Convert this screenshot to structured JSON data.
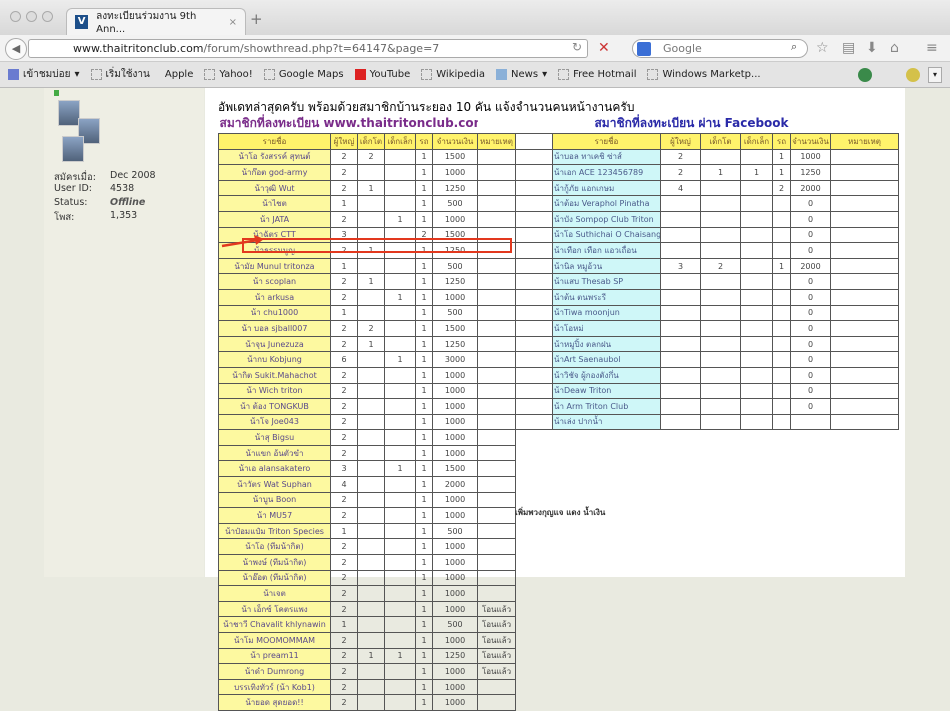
{
  "browser": {
    "tab_title": "ลงทะเบียนร่วมงาน 9th Ann...",
    "url_domain": "www.thaitritonclub.com",
    "url_path": "/forum/showthread.php?t=64147&page=7",
    "search_placeholder": "Google",
    "bookmarks": [
      "เข้าชมบ่อย",
      "เริ่มใช้งาน",
      "Apple",
      "Yahoo!",
      "Google Maps",
      "YouTube",
      "Wikipedia",
      "News",
      "Free Hotmail",
      "Windows Marketp..."
    ]
  },
  "user": {
    "labels": [
      "สมัครเมื่อ:",
      "User ID:",
      "Status:",
      "โพส:"
    ],
    "values": [
      "Dec 2008",
      "4538",
      "Offline",
      "1,353"
    ]
  },
  "post": {
    "headline": "อัพเดทล่าสุดครับ พร้อมด้วยสมาชิกบ้านระยอง 10 คัน แจ้งจำนวนคนหน้างานครับ"
  },
  "left_table": {
    "title": "สมาชิกที่ลงทะเบียน www.thaitritonclub.com",
    "headers": [
      "รายชื่อ",
      "ผู้ใหญ่",
      "เด็กโต",
      "เด็กเล็ก",
      "รถ",
      "จำนวนเงิน",
      "หมายเหตุ"
    ],
    "rows": [
      [
        "น้าโอ รังสรรค์ สุทนต์",
        "2",
        "2",
        "",
        "1",
        "1500",
        ""
      ],
      [
        "น้าก๊อต god-army",
        "2",
        "",
        "",
        "1",
        "1000",
        ""
      ],
      [
        "น้าวุฒิ Wut",
        "2",
        "1",
        "",
        "1",
        "1250",
        ""
      ],
      [
        "น้าไชต",
        "1",
        "",
        "",
        "1",
        "500",
        ""
      ],
      [
        "น้า JATA",
        "2",
        "",
        "1",
        "1",
        "1000",
        ""
      ],
      [
        "น้าฉัตร CTT",
        "3",
        "",
        "",
        "2",
        "1500",
        ""
      ],
      [
        "น้าธรรมนูญ",
        "2",
        "1",
        "",
        "1",
        "1250",
        ""
      ],
      [
        "น้ามัย Munul tritonza",
        "1",
        "",
        "",
        "1",
        "500",
        ""
      ],
      [
        "น้า scoplan",
        "2",
        "1",
        "",
        "1",
        "1250",
        ""
      ],
      [
        "น้า arkusa",
        "2",
        "",
        "1",
        "1",
        "1000",
        ""
      ],
      [
        "น้า chu1000",
        "1",
        "",
        "",
        "1",
        "500",
        ""
      ],
      [
        "น้า บอล sjball007",
        "2",
        "2",
        "",
        "1",
        "1500",
        ""
      ],
      [
        "น้าจุน Junezuza",
        "2",
        "1",
        "",
        "1",
        "1250",
        ""
      ],
      [
        "น้ากบ Kobjung",
        "6",
        "",
        "1",
        "1",
        "3000",
        ""
      ],
      [
        "น้ากิต Sukit.Mahachot",
        "2",
        "",
        "",
        "1",
        "1000",
        ""
      ],
      [
        "น้า Wich triton",
        "2",
        "",
        "",
        "1",
        "1000",
        ""
      ],
      [
        "น้า ต้อง TONGKUB",
        "2",
        "",
        "",
        "1",
        "1000",
        ""
      ],
      [
        "น้าโจ Joe043",
        "2",
        "",
        "",
        "1",
        "1000",
        ""
      ],
      [
        "น้าสุ Bigsu",
        "2",
        "",
        "",
        "1",
        "1000",
        ""
      ],
      [
        "น้าแขก อ้นตัวขำ",
        "2",
        "",
        "",
        "1",
        "1000",
        ""
      ],
      [
        "น้าเอ alansakatero",
        "3",
        "",
        "1",
        "1",
        "1500",
        ""
      ],
      [
        "น้าวัตร Wat Suphan",
        "4",
        "",
        "",
        "1",
        "2000",
        ""
      ],
      [
        "น้าบูน Boon",
        "2",
        "",
        "",
        "1",
        "1000",
        ""
      ],
      [
        "น้า MU57",
        "2",
        "",
        "",
        "1",
        "1000",
        ""
      ],
      [
        "น้าป๋อมแป๋ม Triton Species",
        "1",
        "",
        "",
        "1",
        "500",
        ""
      ],
      [
        "น้าโอ (ทีมน้ากิต)",
        "2",
        "",
        "",
        "1",
        "1000",
        ""
      ],
      [
        "น้าพงษ์ (ทีมน้ากิต)",
        "2",
        "",
        "",
        "1",
        "1000",
        ""
      ],
      [
        "น้าอ๊อต (ทีมน้ากิต)",
        "2",
        "",
        "",
        "1",
        "1000",
        ""
      ],
      [
        "น้าเจต",
        "2",
        "",
        "",
        "1",
        "1000",
        ""
      ],
      [
        "น้า เอ็กซ์ โคตรแพง",
        "2",
        "",
        "",
        "1",
        "1000",
        "โอนแล้ว"
      ],
      [
        "น้าชาวี Chavalit khlynawin",
        "1",
        "",
        "",
        "1",
        "500",
        "โอนแล้ว"
      ],
      [
        "น้าโม MOOMOMMAM",
        "2",
        "",
        "",
        "1",
        "1000",
        "โอนแล้ว"
      ],
      [
        "น้า pream11",
        "2",
        "1",
        "1",
        "1",
        "1250",
        "โอนแล้ว"
      ],
      [
        "น้าดำ Dumrong",
        "2",
        "",
        "",
        "1",
        "1000",
        "โอนแล้ว"
      ],
      [
        "บรรเทิงทัวร์ (น้า Kob1)",
        "2",
        "",
        "",
        "1",
        "1000",
        ""
      ],
      [
        "น้ายอด สุดยอด!!",
        "2",
        "",
        "",
        "1",
        "1000",
        ""
      ]
    ],
    "extra_note": "เพิ่มพวงกุญแจ แดง น้ำเงิน"
  },
  "right_table": {
    "title": "สมาชิกที่ลงทะเบียน ผ่าน Facebook",
    "headers": [
      "รายชื่อ",
      "ผู้ใหญ่",
      "เด็กโต",
      "เด็กเล็ก",
      "รถ",
      "จำนวนเงิน",
      "หมายเหตุ"
    ],
    "rows": [
      [
        "น้าบอล ทาเคชิ ซ่าส์",
        "2",
        "",
        "",
        "1",
        "1000",
        ""
      ],
      [
        "น้าเอก ACE 123456789",
        "2",
        "1",
        "1",
        "1",
        "1250",
        ""
      ],
      [
        "น้ากู้ภัย แอกเกษม",
        "4",
        "",
        "",
        "2",
        "2000",
        ""
      ],
      [
        "น้าต้อม Veraphol Pinatha",
        "",
        "",
        "",
        "",
        "0",
        ""
      ],
      [
        "น้าบัง Sompop Club Triton",
        "",
        "",
        "",
        "",
        "0",
        ""
      ],
      [
        "น้าโอ Suthichai O Chaisang",
        "",
        "",
        "",
        "",
        "0",
        ""
      ],
      [
        "น้าเทือก เทือก แอวเถื่อน",
        "",
        "",
        "",
        "",
        "0",
        ""
      ],
      [
        "น้านิล หมูอ้วน",
        "3",
        "2",
        "",
        "1",
        "2000",
        ""
      ],
      [
        "น้าแสบ Thesab SP",
        "",
        "",
        "",
        "",
        "0",
        ""
      ],
      [
        "น้าต้น ตนพระรี",
        "",
        "",
        "",
        "",
        "0",
        ""
      ],
      [
        "น้าTiwa moonjun",
        "",
        "",
        "",
        "",
        "0",
        ""
      ],
      [
        "น้าโอหม่",
        "",
        "",
        "",
        "",
        "0",
        ""
      ],
      [
        "น้าหมูปิ้ง ตลกฝน",
        "",
        "",
        "",
        "",
        "0",
        ""
      ],
      [
        "น้าArt Saenaubol",
        "",
        "",
        "",
        "",
        "0",
        ""
      ],
      [
        "น้าวิชัจ ผู้กองตังกึ่น",
        "",
        "",
        "",
        "",
        "0",
        ""
      ],
      [
        "น้าDeaw Triton",
        "",
        "",
        "",
        "",
        "0",
        ""
      ],
      [
        "น้า Arm Triton Club",
        "",
        "",
        "",
        "",
        "0",
        ""
      ],
      [
        "น้าเล่ง ปากน้ำ",
        "",
        "",
        "",
        "",
        "",
        ""
      ]
    ]
  },
  "colors": {
    "name_cell": "#fdf9a0",
    "header": "#fff36b",
    "facebook_name_cell": "#cff7f8",
    "highlight": "#e2381e",
    "title_left": "#7a2c8a",
    "title_right": "#2a2aa8"
  }
}
